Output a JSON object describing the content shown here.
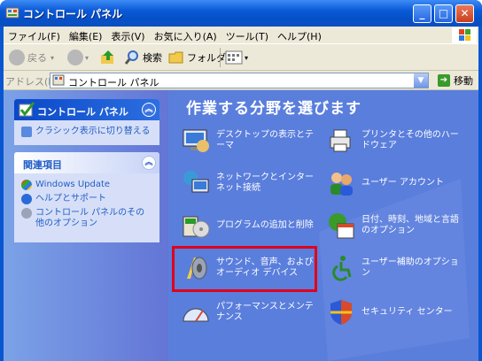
{
  "window": {
    "title": "コントロール パネル"
  },
  "titlebar_buttons": {
    "minimize": "_",
    "maximize": "□",
    "close": "✕"
  },
  "menu": [
    "ファイル(F)",
    "編集(E)",
    "表示(V)",
    "お気に入り(A)",
    "ツール(T)",
    "ヘルプ(H)"
  ],
  "toolbar": {
    "back": "戻る",
    "search": "検索",
    "folders": "フォルダ"
  },
  "address": {
    "label": "アドレス(D)",
    "value": "コントロール パネル",
    "go": "移動"
  },
  "sidebar": {
    "panel1": {
      "title": "コントロール パネル",
      "links": [
        "クラシック表示に切り替える"
      ]
    },
    "panel2": {
      "title": "関連項目",
      "links": [
        "Windows Update",
        "ヘルプとサポート",
        "コントロール パネルのその他のオプション"
      ]
    }
  },
  "main": {
    "heading": "作業する分野を選びます",
    "categories": [
      {
        "label": "デスクトップの表示とテーマ",
        "icon": "display-icon"
      },
      {
        "label": "プリンタとその他のハードウェア",
        "icon": "printer-icon"
      },
      {
        "label": "ネットワークとインターネット接続",
        "icon": "network-icon"
      },
      {
        "label": "ユーザー アカウント",
        "icon": "users-icon"
      },
      {
        "label": "プログラムの追加と削除",
        "icon": "programs-icon"
      },
      {
        "label": "日付、時刻、地域と言語のオプション",
        "icon": "calendar-icon"
      },
      {
        "label": "サウンド、音声、およびオーディオ デバイス",
        "icon": "sound-icon"
      },
      {
        "label": "ユーザー補助のオプション",
        "icon": "accessibility-icon"
      },
      {
        "label": "パフォーマンスとメンテナンス",
        "icon": "performance-icon"
      },
      {
        "label": "セキュリティ センター",
        "icon": "security-shield-icon"
      }
    ]
  },
  "colors": {
    "highlight": "#e0001a",
    "main_bg": "#5a7edc",
    "sidebar_link": "#215dc6"
  }
}
